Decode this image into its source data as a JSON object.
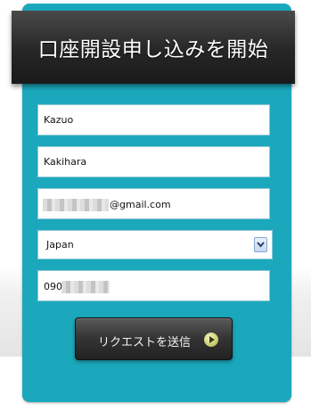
{
  "header": {
    "title": "口座開設申し込みを開始"
  },
  "form": {
    "first_name": "Kazuo",
    "last_name": "Kakihara",
    "email": "@gmail.com",
    "country": "Japan",
    "phone": "090",
    "submit_label": "リクエストを送信"
  },
  "colors": {
    "panel": "#1ba8bd",
    "header": "#262626",
    "button": "#333333"
  }
}
